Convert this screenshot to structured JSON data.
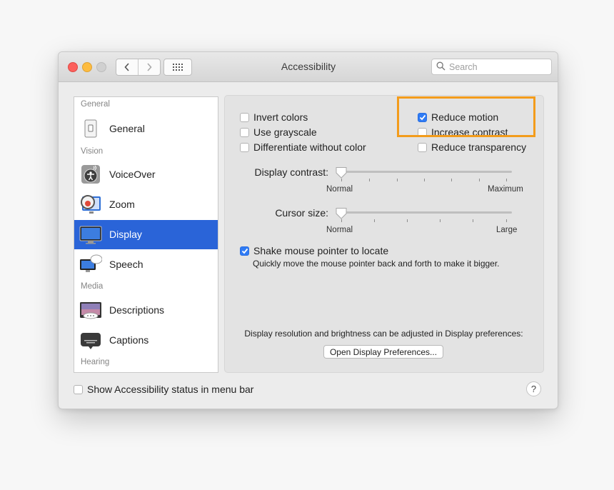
{
  "window": {
    "title": "Accessibility"
  },
  "toolbar": {
    "back_icon": "chevron-left-icon",
    "forward_icon": "chevron-right-icon",
    "show_all_icon": "grid-icon",
    "search_placeholder": "Search"
  },
  "sidebar": {
    "groups": {
      "general": "General",
      "vision": "Vision",
      "media": "Media",
      "hearing": "Hearing"
    },
    "items": [
      {
        "label": "General",
        "icon": "general-switch-icon"
      },
      {
        "label": "VoiceOver",
        "icon": "voiceover-icon"
      },
      {
        "label": "Zoom",
        "icon": "zoom-icon"
      },
      {
        "label": "Display",
        "icon": "display-icon",
        "selected": true
      },
      {
        "label": "Speech",
        "icon": "speech-icon"
      },
      {
        "label": "Descriptions",
        "icon": "descriptions-icon"
      },
      {
        "label": "Captions",
        "icon": "captions-icon"
      }
    ]
  },
  "display": {
    "checkboxes": {
      "invert_colors": {
        "label": "Invert colors",
        "checked": false
      },
      "use_grayscale": {
        "label": "Use grayscale",
        "checked": false
      },
      "differentiate": {
        "label": "Differentiate without color",
        "checked": false
      },
      "reduce_motion": {
        "label": "Reduce motion",
        "checked": true
      },
      "increase_contrast": {
        "label": "Increase contrast",
        "checked": false
      },
      "reduce_transparency": {
        "label": "Reduce transparency",
        "checked": false
      }
    },
    "display_contrast": {
      "label": "Display contrast:",
      "min": "Normal",
      "max": "Maximum",
      "value": 0
    },
    "cursor_size": {
      "label": "Cursor size:",
      "min": "Normal",
      "max": "Large",
      "value": 0
    },
    "shake": {
      "label": "Shake mouse pointer to locate",
      "checked": true,
      "description": "Quickly move the mouse pointer back and forth to make it bigger."
    },
    "footer_note": "Display resolution and brightness can be adjusted in Display preferences:",
    "open_prefs_button": "Open Display Preferences..."
  },
  "bottom": {
    "status_menu": {
      "label": "Show Accessibility status in menu bar",
      "checked": false
    },
    "help": "?"
  },
  "colors": {
    "selection": "#2a64d8",
    "checkbox_checked": "#2f7bf5",
    "highlight": "#f39c1c"
  }
}
